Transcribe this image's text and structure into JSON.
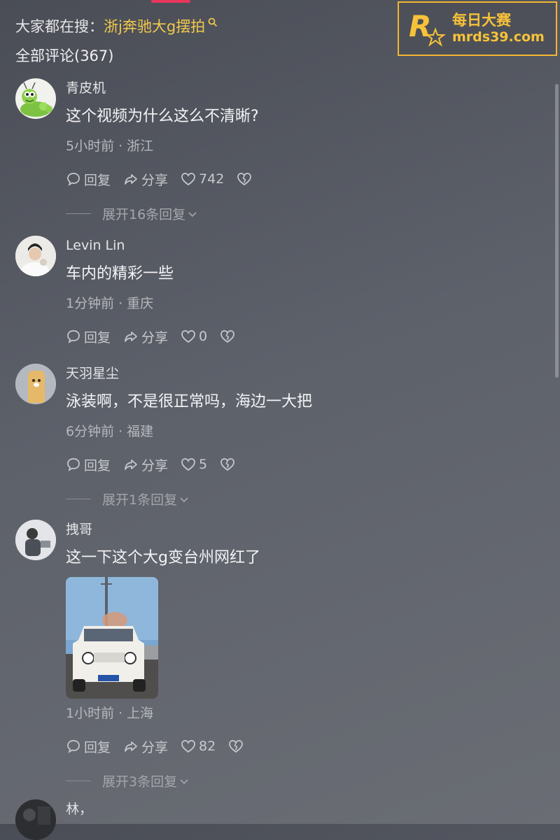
{
  "search": {
    "prefix": "大家都在搜：",
    "term": "浙j奔驰大g摆拍"
  },
  "comments_header": "全部评论(367)",
  "actions": {
    "reply": "回复",
    "share": "分享"
  },
  "comments": [
    {
      "user": "青皮机",
      "text": "这个视频为什么这么不清晰?",
      "time": "5小时前",
      "location": "浙江",
      "likes": "742",
      "expand": "展开16条回复"
    },
    {
      "user": "Levin Lin",
      "text": "车内的精彩一些",
      "time": "1分钟前",
      "location": "重庆",
      "likes": "0"
    },
    {
      "user": "天羽星尘",
      "text": "泳装啊，不是很正常吗，海边一大把",
      "time": "6分钟前",
      "location": "福建",
      "likes": "5",
      "expand": "展开1条回复"
    },
    {
      "user": "拽哥",
      "text": "这一下这个大g变台州网红了",
      "time": "1小时前",
      "location": "上海",
      "likes": "82",
      "expand": "展开3条回复"
    },
    {
      "user": "林，"
    }
  ],
  "watermark": {
    "title": "每日大赛",
    "url": "mrds39.com",
    "logo_letter": "R"
  },
  "colors": {
    "accent_pink": "#e8365d",
    "search_term": "#f2c94c",
    "watermark": "#f7c23a"
  }
}
